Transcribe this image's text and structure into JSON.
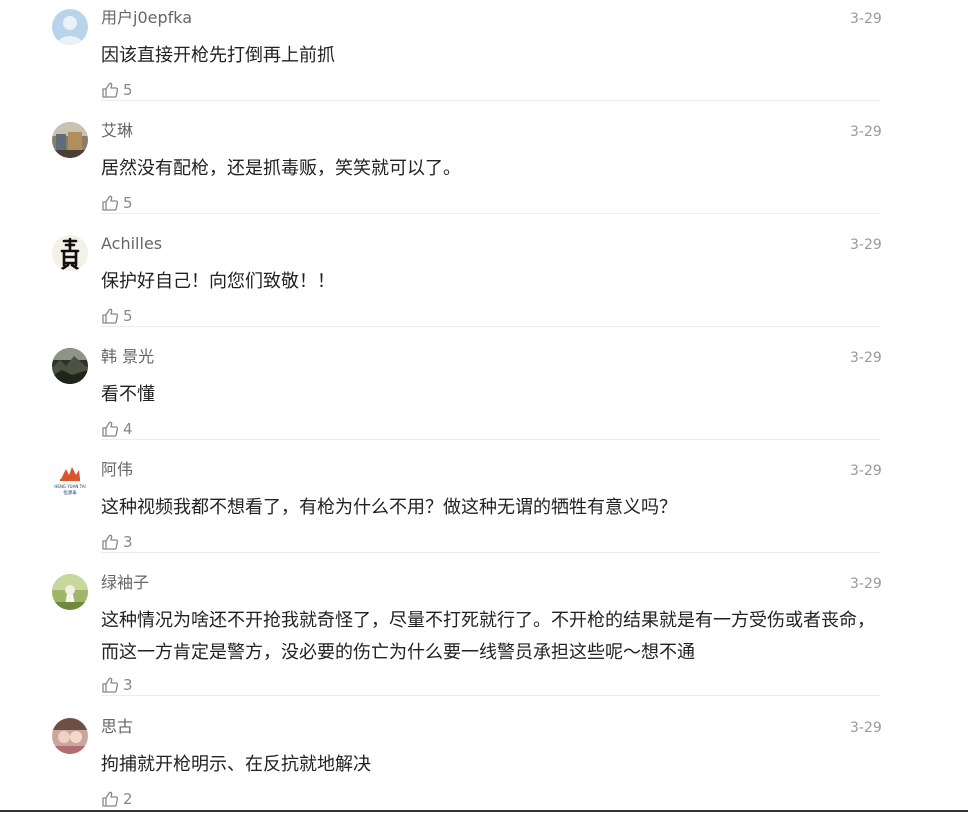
{
  "comments": [
    {
      "username": "用户j0epfka",
      "date": "3-29",
      "content": "因该直接开枪先打倒再上前抓",
      "likes": "5",
      "avatar": "default-user-avatar"
    },
    {
      "username": "艾琳",
      "date": "3-29",
      "content": "居然没有配枪，还是抓毒贩，笑笑就可以了。",
      "likes": "5",
      "avatar": "photo-avatar"
    },
    {
      "username": "Achilles",
      "date": "3-29",
      "content": "保护好自己！向您们致敬！！",
      "likes": "5",
      "avatar": "calligraphy-dragon-avatar"
    },
    {
      "username": "韩 景光",
      "date": "3-29",
      "content": "看不懂",
      "likes": "4",
      "avatar": "landscape-avatar"
    },
    {
      "username": "阿伟",
      "date": "3-29",
      "content": "这种视频我都不想看了，有枪为什么不用？做这种无谓的牺牲有意义吗？",
      "likes": "3",
      "avatar": "logo-avatar",
      "avatar_text": "HENG YUAN TAI",
      "avatar_text_cn": "恒源泰"
    },
    {
      "username": "绿袖子",
      "date": "3-29",
      "content": "这种情况为啥还不开抢我就奇怪了，尽量不打死就行了。不开枪的结果就是有一方受伤或者丧命，而这一方肯定是警方，没必要的伤亡为什么要一线警员承担这些呢～想不通",
      "likes": "3",
      "avatar": "nature-avatar"
    },
    {
      "username": "思古",
      "date": "3-29",
      "content": "拘捕就开枪明示、在反抗就地解决",
      "likes": "2",
      "avatar": "people-photo-avatar"
    }
  ],
  "icons": {
    "like": "thumbs-up-icon"
  },
  "colors": {
    "username": "#666666",
    "date": "#999999",
    "content": "#222222",
    "likes": "#888888"
  }
}
